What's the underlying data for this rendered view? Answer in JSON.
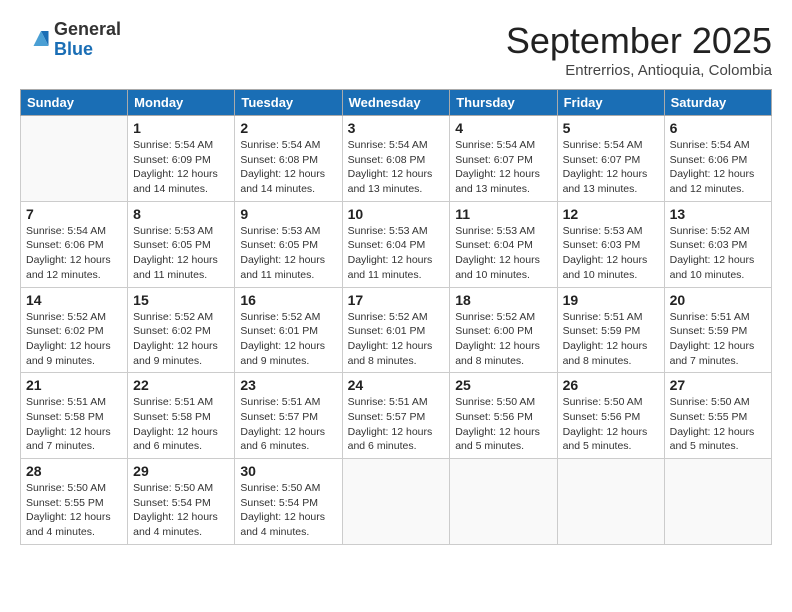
{
  "logo": {
    "general": "General",
    "blue": "Blue"
  },
  "header": {
    "month_title": "September 2025",
    "subtitle": "Entrerrios, Antioquia, Colombia"
  },
  "weekdays": [
    "Sunday",
    "Monday",
    "Tuesday",
    "Wednesday",
    "Thursday",
    "Friday",
    "Saturday"
  ],
  "weeks": [
    [
      {
        "day": "",
        "info": ""
      },
      {
        "day": "1",
        "info": "Sunrise: 5:54 AM\nSunset: 6:09 PM\nDaylight: 12 hours\nand 14 minutes."
      },
      {
        "day": "2",
        "info": "Sunrise: 5:54 AM\nSunset: 6:08 PM\nDaylight: 12 hours\nand 14 minutes."
      },
      {
        "day": "3",
        "info": "Sunrise: 5:54 AM\nSunset: 6:08 PM\nDaylight: 12 hours\nand 13 minutes."
      },
      {
        "day": "4",
        "info": "Sunrise: 5:54 AM\nSunset: 6:07 PM\nDaylight: 12 hours\nand 13 minutes."
      },
      {
        "day": "5",
        "info": "Sunrise: 5:54 AM\nSunset: 6:07 PM\nDaylight: 12 hours\nand 13 minutes."
      },
      {
        "day": "6",
        "info": "Sunrise: 5:54 AM\nSunset: 6:06 PM\nDaylight: 12 hours\nand 12 minutes."
      }
    ],
    [
      {
        "day": "7",
        "info": "Sunrise: 5:54 AM\nSunset: 6:06 PM\nDaylight: 12 hours\nand 12 minutes."
      },
      {
        "day": "8",
        "info": "Sunrise: 5:53 AM\nSunset: 6:05 PM\nDaylight: 12 hours\nand 11 minutes."
      },
      {
        "day": "9",
        "info": "Sunrise: 5:53 AM\nSunset: 6:05 PM\nDaylight: 12 hours\nand 11 minutes."
      },
      {
        "day": "10",
        "info": "Sunrise: 5:53 AM\nSunset: 6:04 PM\nDaylight: 12 hours\nand 11 minutes."
      },
      {
        "day": "11",
        "info": "Sunrise: 5:53 AM\nSunset: 6:04 PM\nDaylight: 12 hours\nand 10 minutes."
      },
      {
        "day": "12",
        "info": "Sunrise: 5:53 AM\nSunset: 6:03 PM\nDaylight: 12 hours\nand 10 minutes."
      },
      {
        "day": "13",
        "info": "Sunrise: 5:52 AM\nSunset: 6:03 PM\nDaylight: 12 hours\nand 10 minutes."
      }
    ],
    [
      {
        "day": "14",
        "info": "Sunrise: 5:52 AM\nSunset: 6:02 PM\nDaylight: 12 hours\nand 9 minutes."
      },
      {
        "day": "15",
        "info": "Sunrise: 5:52 AM\nSunset: 6:02 PM\nDaylight: 12 hours\nand 9 minutes."
      },
      {
        "day": "16",
        "info": "Sunrise: 5:52 AM\nSunset: 6:01 PM\nDaylight: 12 hours\nand 9 minutes."
      },
      {
        "day": "17",
        "info": "Sunrise: 5:52 AM\nSunset: 6:01 PM\nDaylight: 12 hours\nand 8 minutes."
      },
      {
        "day": "18",
        "info": "Sunrise: 5:52 AM\nSunset: 6:00 PM\nDaylight: 12 hours\nand 8 minutes."
      },
      {
        "day": "19",
        "info": "Sunrise: 5:51 AM\nSunset: 5:59 PM\nDaylight: 12 hours\nand 8 minutes."
      },
      {
        "day": "20",
        "info": "Sunrise: 5:51 AM\nSunset: 5:59 PM\nDaylight: 12 hours\nand 7 minutes."
      }
    ],
    [
      {
        "day": "21",
        "info": "Sunrise: 5:51 AM\nSunset: 5:58 PM\nDaylight: 12 hours\nand 7 minutes."
      },
      {
        "day": "22",
        "info": "Sunrise: 5:51 AM\nSunset: 5:58 PM\nDaylight: 12 hours\nand 6 minutes."
      },
      {
        "day": "23",
        "info": "Sunrise: 5:51 AM\nSunset: 5:57 PM\nDaylight: 12 hours\nand 6 minutes."
      },
      {
        "day": "24",
        "info": "Sunrise: 5:51 AM\nSunset: 5:57 PM\nDaylight: 12 hours\nand 6 minutes."
      },
      {
        "day": "25",
        "info": "Sunrise: 5:50 AM\nSunset: 5:56 PM\nDaylight: 12 hours\nand 5 minutes."
      },
      {
        "day": "26",
        "info": "Sunrise: 5:50 AM\nSunset: 5:56 PM\nDaylight: 12 hours\nand 5 minutes."
      },
      {
        "day": "27",
        "info": "Sunrise: 5:50 AM\nSunset: 5:55 PM\nDaylight: 12 hours\nand 5 minutes."
      }
    ],
    [
      {
        "day": "28",
        "info": "Sunrise: 5:50 AM\nSunset: 5:55 PM\nDaylight: 12 hours\nand 4 minutes."
      },
      {
        "day": "29",
        "info": "Sunrise: 5:50 AM\nSunset: 5:54 PM\nDaylight: 12 hours\nand 4 minutes."
      },
      {
        "day": "30",
        "info": "Sunrise: 5:50 AM\nSunset: 5:54 PM\nDaylight: 12 hours\nand 4 minutes."
      },
      {
        "day": "",
        "info": ""
      },
      {
        "day": "",
        "info": ""
      },
      {
        "day": "",
        "info": ""
      },
      {
        "day": "",
        "info": ""
      }
    ]
  ]
}
